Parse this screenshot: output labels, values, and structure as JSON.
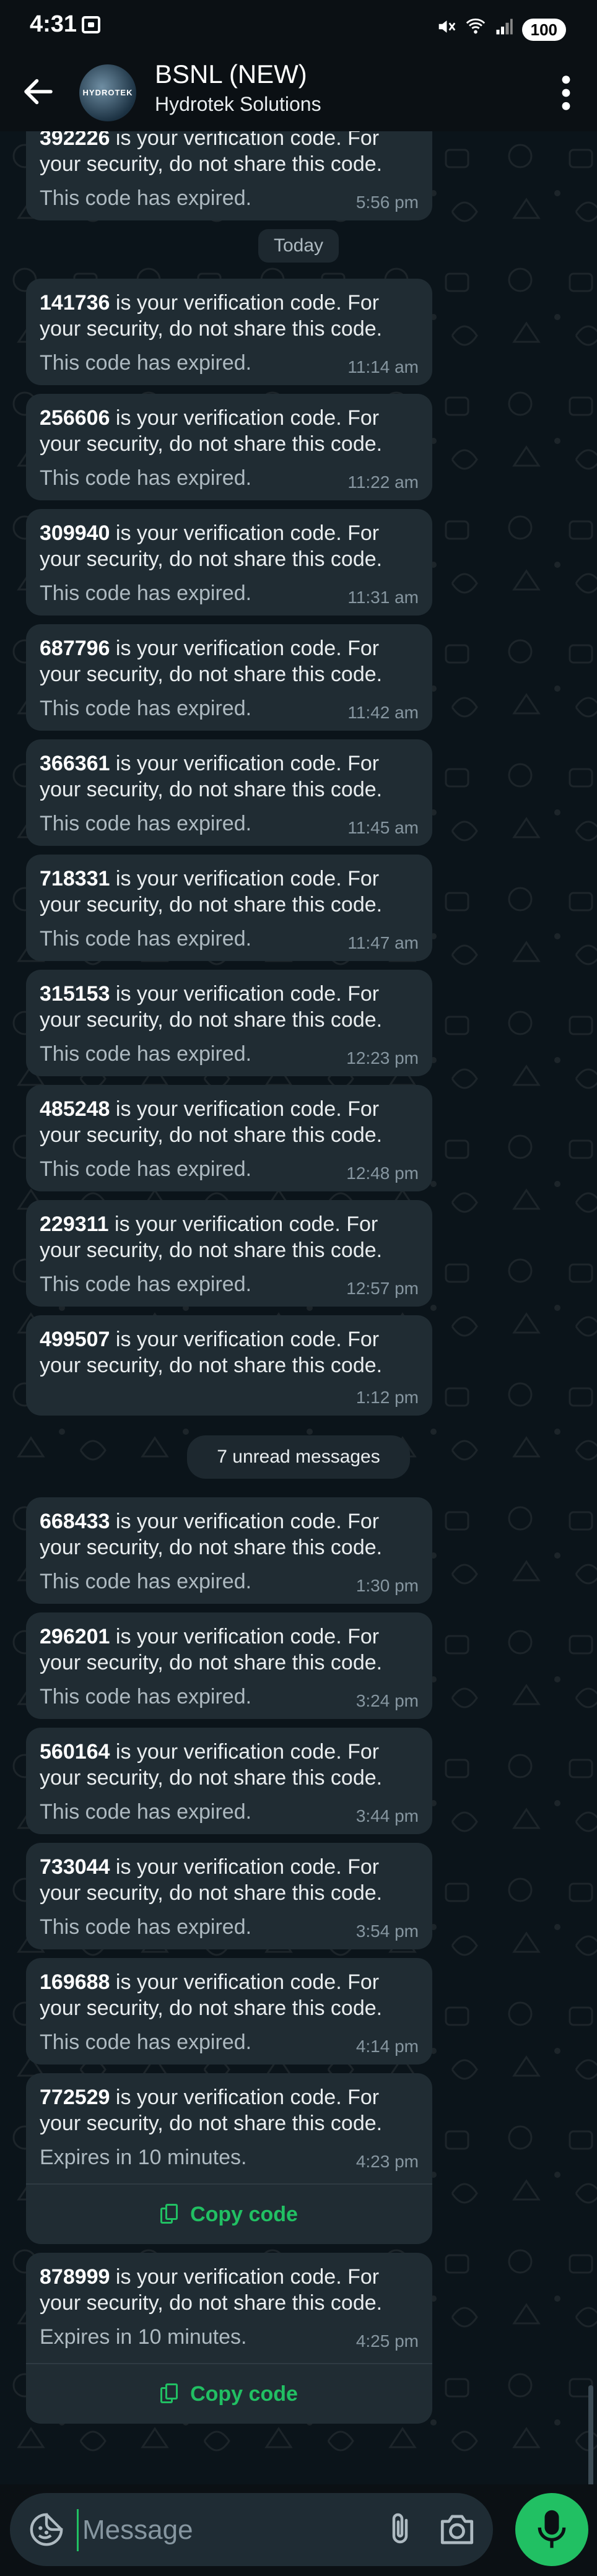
{
  "status_bar": {
    "time": "4:31",
    "battery": "100"
  },
  "header": {
    "title": "BSNL (NEW)",
    "subtitle": "Hydrotek Solutions",
    "avatar_text": "HYDROTEK"
  },
  "messages_before": [
    {
      "code": "392226",
      "text": " is your verification code. For your security, do not share this code.",
      "expiry": "This code has expired.",
      "time": "5:56 pm"
    }
  ],
  "date_chip": "Today",
  "messages_today": [
    {
      "code": "141736",
      "text": " is your verification code. For your security, do not share this code.",
      "expiry": "This code has expired.",
      "time": "11:14 am"
    },
    {
      "code": "256606",
      "text": " is your verification code. For your security, do not share this code.",
      "expiry": "This code has expired.",
      "time": "11:22 am"
    },
    {
      "code": "309940",
      "text": " is your verification code. For your security, do not share this code.",
      "expiry": "This code has expired.",
      "time": "11:31 am"
    },
    {
      "code": "687796",
      "text": " is your verification code. For your security, do not share this code.",
      "expiry": "This code has expired.",
      "time": "11:42 am"
    },
    {
      "code": "366361",
      "text": " is your verification code. For your security, do not share this code.",
      "expiry": "This code has expired.",
      "time": "11:45 am"
    },
    {
      "code": "718331",
      "text": " is your verification code. For your security, do not share this code.",
      "expiry": "This code has expired.",
      "time": "11:47 am"
    },
    {
      "code": "315153",
      "text": " is your verification code. For your security, do not share this code.",
      "expiry": "This code has expired.",
      "time": "12:23 pm"
    },
    {
      "code": "485248",
      "text": " is your verification code. For your security, do not share this code.",
      "expiry": "This code has expired.",
      "time": "12:48 pm"
    },
    {
      "code": "229311",
      "text": " is your verification code. For your security, do not share this code.",
      "expiry": "This code has expired.",
      "time": "12:57 pm"
    },
    {
      "code": "499507",
      "text": " is your verification code. For your security, do not share this code.",
      "expiry": "",
      "time": "1:12 pm"
    }
  ],
  "unread_chip": "7 unread messages",
  "messages_unread": [
    {
      "code": "668433",
      "text": " is your verification code. For your security, do not share this code.",
      "expiry": "This code has expired.",
      "time": "1:30 pm"
    },
    {
      "code": "296201",
      "text": " is your verification code. For your security, do not share this code.",
      "expiry": "This code has expired.",
      "time": "3:24 pm"
    },
    {
      "code": "560164",
      "text": " is your verification code. For your security, do not share this code.",
      "expiry": "This code has expired.",
      "time": "3:44 pm"
    },
    {
      "code": "733044",
      "text": " is your verification code. For your security, do not share this code.",
      "expiry": "This code has expired.",
      "time": "3:54 pm"
    },
    {
      "code": "169688",
      "text": " is your verification code. For your security, do not share this code.",
      "expiry": "This code has expired.",
      "time": "4:14 pm"
    },
    {
      "code": "772529",
      "text": " is your verification code. For your security, do not share this code.",
      "expiry": "Expires in 10 minutes.",
      "time": "4:23 pm",
      "copy_label": "Copy code"
    },
    {
      "code": "878999",
      "text": " is your verification code. For your security, do not share this code.",
      "expiry": "Expires in 10 minutes.",
      "time": "4:25 pm",
      "copy_label": "Copy code"
    }
  ],
  "input_bar": {
    "placeholder": "Message"
  },
  "icons": {
    "back": "arrow-left-icon",
    "menu": "more-vertical-icon",
    "emoji": "sticker-smiley-icon",
    "attach": "paperclip-icon",
    "camera": "camera-icon",
    "mic": "microphone-icon",
    "copy": "copy-icon"
  },
  "colors": {
    "accent": "#21c063",
    "bubble": "#202c33",
    "background": "#0b141a"
  }
}
